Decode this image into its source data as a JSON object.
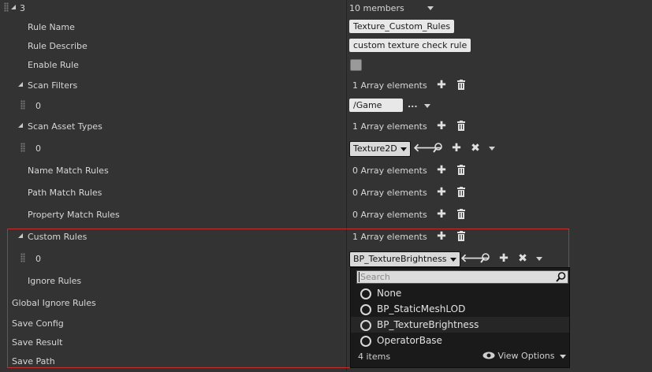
{
  "root": {
    "index_label": "3",
    "members_label": "10 members"
  },
  "rule_name": {
    "label": "Rule Name",
    "value": "Texture_Custom_Rules"
  },
  "rule_describe": {
    "label": "Rule Describe",
    "value": "custom texture check rule"
  },
  "enable_rule": {
    "label": "Enable Rule",
    "checked": false
  },
  "scan_filters": {
    "label": "Scan Filters",
    "count": "1 Array elements",
    "item": {
      "index": "0",
      "value": "/Game",
      "more": "..."
    }
  },
  "scan_asset_types": {
    "label": "Scan Asset Types",
    "count": "1 Array elements",
    "item": {
      "index": "0",
      "value": "Texture2D"
    }
  },
  "name_match_rules": {
    "label": "Name Match Rules",
    "count": "0 Array elements"
  },
  "path_match_rules": {
    "label": "Path Match Rules",
    "count": "0 Array elements"
  },
  "property_match_rules": {
    "label": "Property Match Rules",
    "count": "0 Array elements"
  },
  "custom_rules": {
    "label": "Custom Rules",
    "count": "1 Array elements",
    "item": {
      "index": "0",
      "value": "BP_TextureBrightness"
    }
  },
  "ignore_rules": {
    "label": "Ignore Rules"
  },
  "global_ignore_rules": {
    "label": "Global Ignore Rules"
  },
  "save_config": {
    "label": "Save Config"
  },
  "save_result": {
    "label": "Save Result"
  },
  "save_path": {
    "label": "Save Path"
  },
  "popup": {
    "search_placeholder": "Search",
    "options": [
      {
        "label": "None"
      },
      {
        "label": "BP_StaticMeshLOD"
      },
      {
        "label": "BP_TextureBrightness"
      },
      {
        "label": "OperatorBase"
      }
    ],
    "footer_count": "4 items",
    "view_options": "View Options"
  },
  "icons": [
    "plus-icon",
    "trash-icon",
    "arrow-left-icon",
    "magnifier-icon",
    "close-icon",
    "eye-icon",
    "dropdown-arrow-icon",
    "expand-arrow-icon",
    "grip-icon"
  ],
  "colors": {
    "background": "#333333",
    "highlight_border": "#c42d2d",
    "popup_background": "#1a1a1a"
  }
}
